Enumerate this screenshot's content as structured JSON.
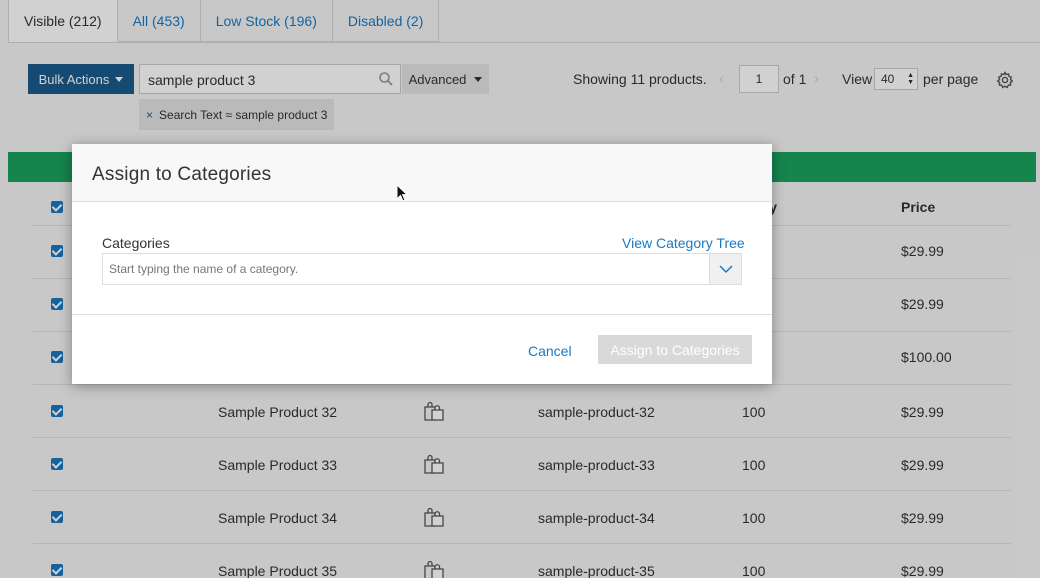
{
  "tabs": [
    {
      "label": "Visible (212)",
      "active": true
    },
    {
      "label": "All (453)",
      "active": false
    },
    {
      "label": "Low Stock (196)",
      "active": false
    },
    {
      "label": "Disabled (2)",
      "active": false
    }
  ],
  "toolbar": {
    "bulk_actions_label": "Bulk Actions",
    "search_value": "sample product 3",
    "advanced_label": "Advanced",
    "filter_chip_label": "Search Text ≈ sample product 3",
    "filter_chip_close": "×",
    "showing_text": "Showing 11 products.",
    "page_prev": "‹",
    "page_value": "1",
    "page_of": "of 1",
    "page_next": "›",
    "view_label": "View",
    "per_page_value": "40",
    "per_page_label": "per page"
  },
  "table": {
    "headers": {
      "inventory": "ntory",
      "price": "Price"
    },
    "rows": [
      {
        "name": "",
        "sku": "",
        "inventory": "",
        "price": "$29.99"
      },
      {
        "name": "",
        "sku": "",
        "inventory": "",
        "price": "$29.99"
      },
      {
        "name": "",
        "sku": "",
        "inventory": "",
        "price": "$100.00"
      },
      {
        "name": "Sample Product 32",
        "sku": "sample-product-32",
        "inventory": "100",
        "price": "$29.99"
      },
      {
        "name": "Sample Product 33",
        "sku": "sample-product-33",
        "inventory": "100",
        "price": "$29.99"
      },
      {
        "name": "Sample Product 34",
        "sku": "sample-product-34",
        "inventory": "100",
        "price": "$29.99"
      },
      {
        "name": "Sample Product 35",
        "sku": "sample-product-35",
        "inventory": "100",
        "price": "$29.99"
      }
    ]
  },
  "modal": {
    "title": "Assign to Categories",
    "categories_label": "Categories",
    "view_tree_link": "View Category Tree",
    "categories_placeholder": "Start typing the name of a category.",
    "cancel_label": "Cancel",
    "assign_label": "Assign to Categories"
  },
  "colors": {
    "accent_blue": "#1979c3",
    "bulk_button": "#1a5c8c",
    "green_bar": "#1aa15f",
    "disabled_button": "#d9d9d9"
  }
}
